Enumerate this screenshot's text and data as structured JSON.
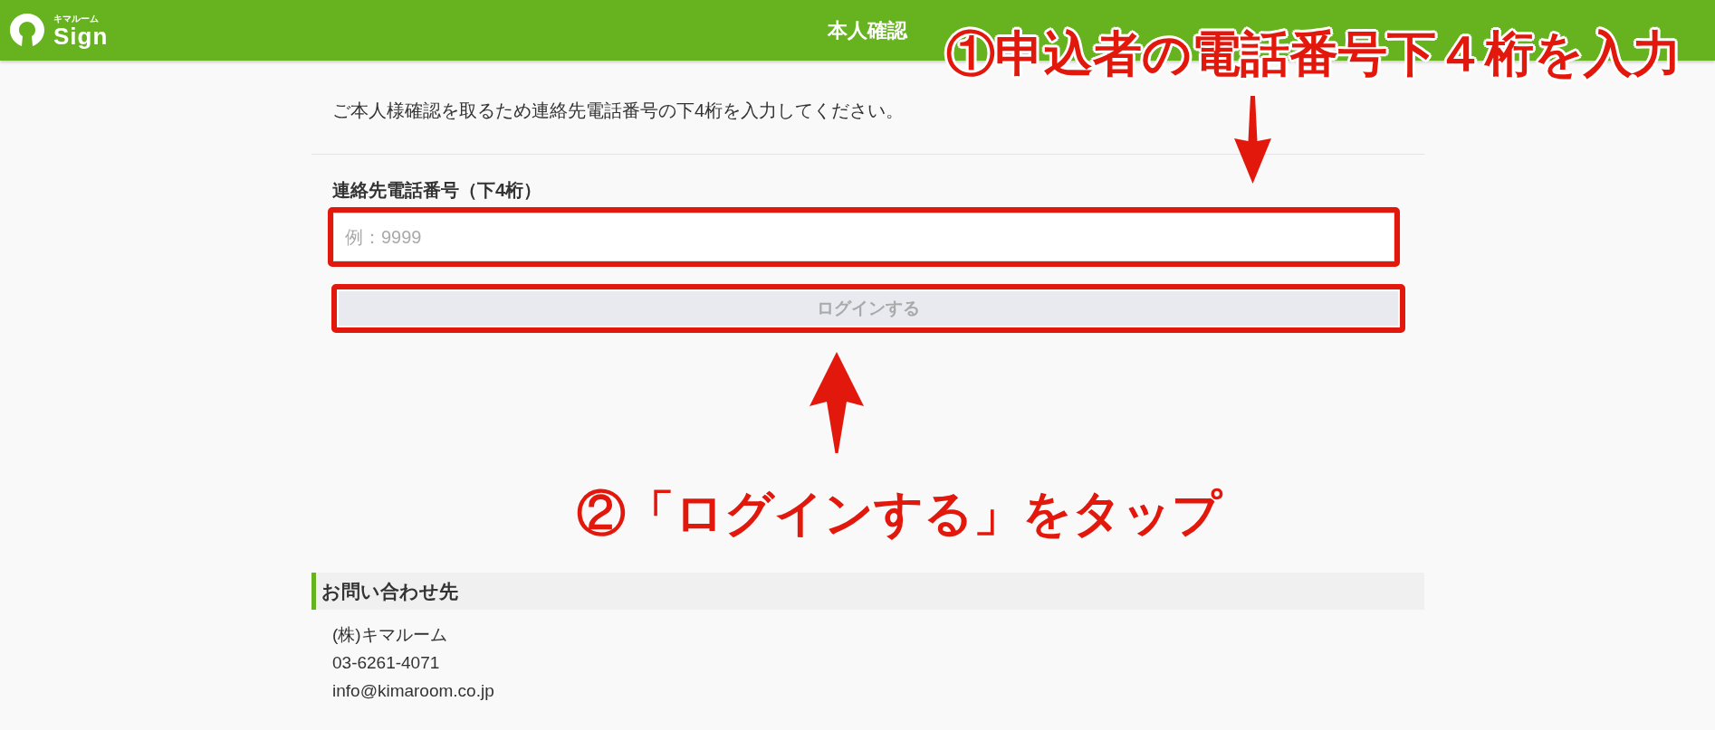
{
  "header": {
    "logo": {
      "caption": "キマルーム",
      "text": "Sign"
    },
    "title": "本人確認"
  },
  "intro": "ご本人様確認を取るため連絡先電話番号の下4桁を入力してください。",
  "form": {
    "field": {
      "label": "連絡先電話番号（下4桁）",
      "placeholder": "例：9999"
    },
    "button": {
      "label": "ログインする",
      "disabled": true
    }
  },
  "contact": {
    "title": "お問い合わせ先",
    "lines": [
      "(株)キマルーム",
      "03-6261-4071",
      "info@kimaroom.co.jp"
    ]
  },
  "annotations": {
    "step_1": "①申込者の電話番号下４桁を入力",
    "step_2": "②「ログインする」をタップ"
  }
}
